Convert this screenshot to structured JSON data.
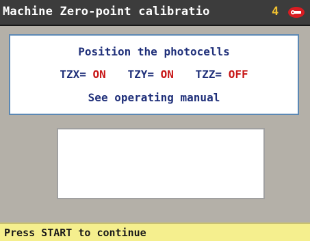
{
  "header": {
    "title": "Machine Zero-point calibratio",
    "page_number": "4",
    "logo_icon": "keyline-logo-icon"
  },
  "message": {
    "instruction": "Position the photocells",
    "photocells": [
      {
        "label": "TZX=",
        "state": "ON"
      },
      {
        "label": "TZY=",
        "state": "ON"
      },
      {
        "label": "TZZ=",
        "state": "OFF"
      }
    ],
    "manual_note": "See operating manual"
  },
  "status_bar": {
    "text": "Press START to continue"
  },
  "colors": {
    "title_bg": "#3c3c3c",
    "page_number": "#f2c230",
    "text_blue": "#20307a",
    "state_red": "#c81818",
    "status_bg": "#f5ef8e",
    "screen_bg": "#b4b0a8",
    "panel_border": "#5b88b4"
  }
}
